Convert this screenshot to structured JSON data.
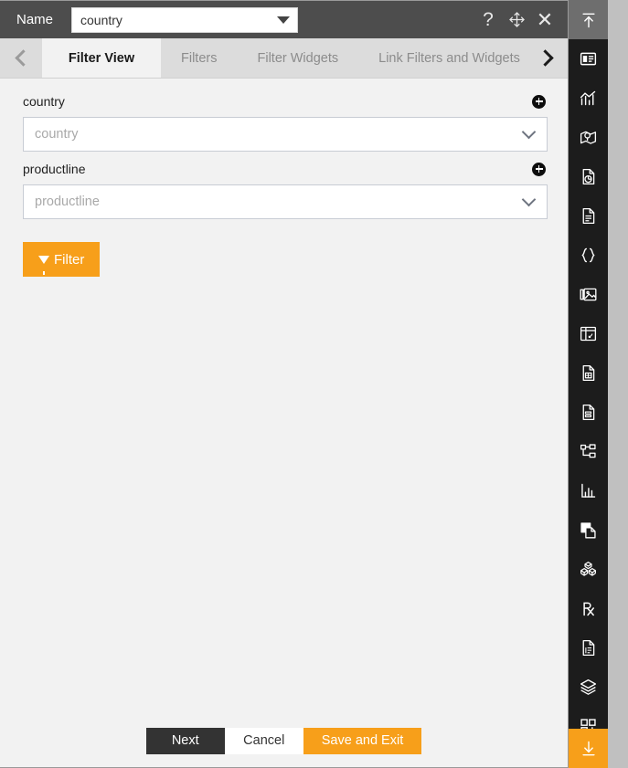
{
  "window": {
    "name_label": "Name",
    "name_value": "country",
    "icons": {
      "help": "?",
      "move": "move-icon",
      "close": "✕"
    }
  },
  "tabs": {
    "prev_label": "previous-tab-arrow",
    "next_label": "next-tab-arrow",
    "items": [
      {
        "label": "Filter View",
        "active": true
      },
      {
        "label": "Filters",
        "active": false
      },
      {
        "label": "Filter Widgets",
        "active": false
      },
      {
        "label": "Link Filters and Widgets",
        "active": false
      }
    ]
  },
  "form": {
    "fields": [
      {
        "label": "country",
        "placeholder": "country",
        "add_title": "add-country-filter"
      },
      {
        "label": "productline",
        "placeholder": "productline",
        "add_title": "add-productline-filter"
      }
    ],
    "filter_button": "Filter"
  },
  "footer": {
    "next": "Next",
    "cancel": "Cancel",
    "save_and_exit": "Save and Exit"
  },
  "rail": {
    "top": {
      "name": "collapse-panel-up-icon"
    },
    "items": [
      {
        "name": "dashboard-icon"
      },
      {
        "name": "chart-icon"
      },
      {
        "name": "map-icon"
      },
      {
        "name": "report-pie-icon"
      },
      {
        "name": "document-icon"
      },
      {
        "name": "braces-icon"
      },
      {
        "name": "gallery-icon"
      },
      {
        "name": "layout-panel-icon"
      },
      {
        "name": "page-icon"
      },
      {
        "name": "form-document-icon"
      },
      {
        "name": "hierarchy-tree-icon"
      },
      {
        "name": "bar-axis-icon"
      },
      {
        "name": "duplicate-page-icon"
      },
      {
        "name": "cubes-icon"
      },
      {
        "name": "prescription-rx-icon"
      },
      {
        "name": "script-document-icon"
      },
      {
        "name": "layers-icon"
      },
      {
        "name": "add-widget-grid-icon"
      }
    ],
    "bottom": {
      "name": "expand-panel-down-icon"
    }
  },
  "colors": {
    "accent": "#f79f1a",
    "titlebar": "#4d4d4d",
    "rail": "#1c1c1c",
    "panel": "#f2f2f2",
    "tabbar": "#dcdcdc"
  }
}
